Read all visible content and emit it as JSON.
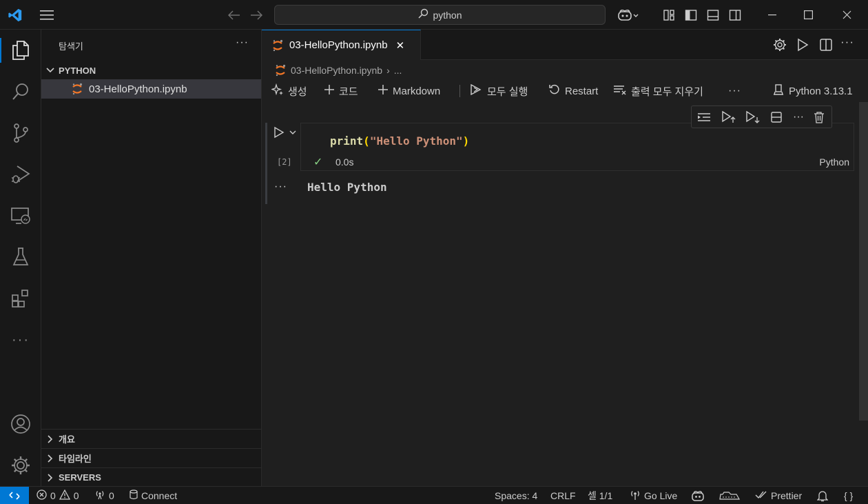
{
  "titlebar": {
    "search_text": "python",
    "icons": [
      "vscode-logo",
      "menu-icon",
      "back-arrow-icon",
      "forward-arrow-icon",
      "search-icon",
      "copilot-icon",
      "layout-customize-icon",
      "toggle-primary-sidebar-icon",
      "toggle-panel-icon",
      "toggle-secondary-sidebar-icon",
      "minimize-icon",
      "maximize-icon",
      "close-icon"
    ]
  },
  "activitybar": {
    "items": [
      "explorer-icon",
      "search-icon",
      "source-control-icon",
      "run-debug-icon",
      "remote-explorer-icon",
      "testing-icon",
      "extensions-icon",
      "more-icon",
      "accounts-icon",
      "manage-gear-icon"
    ],
    "more_label": "···"
  },
  "sidebar": {
    "title": "탐색기",
    "more": "···",
    "folder": "PYTHON",
    "file": "03-HelloPython.ipynb",
    "sections": [
      "개요",
      "타임라인",
      "SERVERS"
    ]
  },
  "editor": {
    "tab_label": "03-HelloPython.ipynb",
    "tab_close": "✕",
    "breadcrumb_file": "03-HelloPython.ipynb",
    "breadcrumb_sep": "›",
    "breadcrumb_more": "...",
    "toolbar": {
      "generate": "생성",
      "code": "코드",
      "markdown": "Markdown",
      "run_all": "모두 실행",
      "restart": "Restart",
      "clear_outputs": "출력 모두 지우기",
      "more": "···",
      "kernel": "Python 3.13.1"
    }
  },
  "cell": {
    "code_fn": "print",
    "code_open": "(",
    "code_str": "\"Hello Python\"",
    "code_close": ")",
    "exec_count": "[2]",
    "check": "✓",
    "duration": "0.0s",
    "language": "Python",
    "output_more": "···",
    "output_text": "Hello Python",
    "cell_toolbar_more": "···"
  },
  "statusbar": {
    "errors": "0",
    "warnings": "0",
    "ports": "0",
    "connect": "Connect",
    "spaces": "Spaces: 4",
    "eol": "CRLF",
    "cell_pos": "셀 1/1",
    "go_live": "Go Live",
    "prettier": "Prettier",
    "braces": "{ }"
  },
  "colors": {
    "accent": "#0078d4",
    "jupyter_orange": "#f37626",
    "success_green": "#89d185",
    "string_orange": "#ce9178",
    "function_yellow": "#dcdcaa"
  }
}
